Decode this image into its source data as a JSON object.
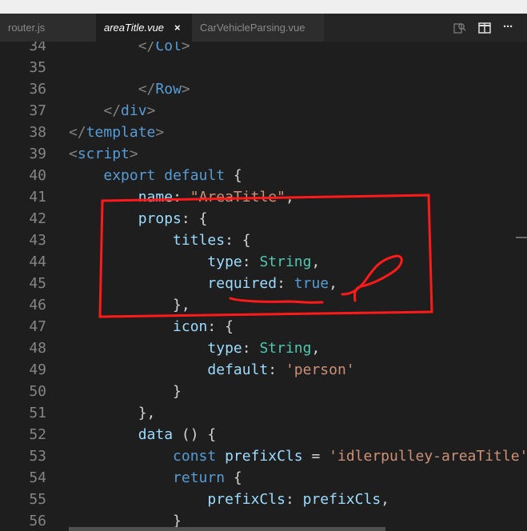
{
  "tabs": [
    {
      "label": "router.js",
      "active": false
    },
    {
      "label": "areaTitle.vue",
      "active": true
    },
    {
      "label": "CarVehicleParsing.vue",
      "active": false
    }
  ],
  "tab_close_glyph": "×",
  "toolbar_icons": [
    "open-changes-icon",
    "split-editor-icon",
    "more-actions-icon"
  ],
  "more_glyph": "···",
  "colors": {
    "background": "#1e1e1e",
    "keyword": "#569cd6",
    "property": "#9cdcfe",
    "type": "#4ec9b0",
    "string": "#ce9178",
    "line_number": "#858585",
    "annotation": "#ff1a1a"
  },
  "code_lines": [
    {
      "n": "34",
      "tokens": [
        [
          "text",
          "        "
        ],
        [
          "punct",
          "</"
        ],
        [
          "tag",
          "Col"
        ],
        [
          "punct",
          ">"
        ]
      ]
    },
    {
      "n": "35",
      "tokens": []
    },
    {
      "n": "36",
      "tokens": [
        [
          "text",
          "        "
        ],
        [
          "punct",
          "</"
        ],
        [
          "tag",
          "Row"
        ],
        [
          "punct",
          ">"
        ]
      ]
    },
    {
      "n": "37",
      "tokens": [
        [
          "text",
          "    "
        ],
        [
          "punct",
          "</"
        ],
        [
          "tag",
          "div"
        ],
        [
          "punct",
          ">"
        ]
      ]
    },
    {
      "n": "38",
      "tokens": [
        [
          "punct",
          "</"
        ],
        [
          "tag",
          "template"
        ],
        [
          "punct",
          ">"
        ]
      ]
    },
    {
      "n": "39",
      "tokens": [
        [
          "punct",
          "<"
        ],
        [
          "tag",
          "script"
        ],
        [
          "punct",
          ">"
        ]
      ]
    },
    {
      "n": "40",
      "tokens": [
        [
          "text",
          "    "
        ],
        [
          "key",
          "export"
        ],
        [
          "text",
          " "
        ],
        [
          "key",
          "default"
        ],
        [
          "text",
          " {"
        ]
      ]
    },
    {
      "n": "41",
      "tokens": [
        [
          "text",
          "        "
        ],
        [
          "prop",
          "name"
        ],
        [
          "text",
          ": "
        ],
        [
          "str",
          "\"AreaTitle\""
        ],
        [
          "text",
          ","
        ]
      ]
    },
    {
      "n": "42",
      "tokens": [
        [
          "text",
          "        "
        ],
        [
          "prop",
          "props"
        ],
        [
          "text",
          ": {"
        ]
      ]
    },
    {
      "n": "43",
      "tokens": [
        [
          "text",
          "            "
        ],
        [
          "prop",
          "titles"
        ],
        [
          "text",
          ": {"
        ]
      ]
    },
    {
      "n": "44",
      "tokens": [
        [
          "text",
          "                "
        ],
        [
          "prop",
          "type"
        ],
        [
          "text",
          ": "
        ],
        [
          "type",
          "String"
        ],
        [
          "text",
          ","
        ]
      ]
    },
    {
      "n": "45",
      "tokens": [
        [
          "text",
          "                "
        ],
        [
          "prop",
          "required"
        ],
        [
          "text",
          ": "
        ],
        [
          "key",
          "true"
        ],
        [
          "text",
          ","
        ]
      ]
    },
    {
      "n": "46",
      "tokens": [
        [
          "text",
          "            },"
        ]
      ]
    },
    {
      "n": "47",
      "tokens": [
        [
          "text",
          "            "
        ],
        [
          "prop",
          "icon"
        ],
        [
          "text",
          ": {"
        ]
      ]
    },
    {
      "n": "48",
      "tokens": [
        [
          "text",
          "                "
        ],
        [
          "prop",
          "type"
        ],
        [
          "text",
          ": "
        ],
        [
          "type",
          "String"
        ],
        [
          "text",
          ","
        ]
      ]
    },
    {
      "n": "49",
      "tokens": [
        [
          "text",
          "                "
        ],
        [
          "prop",
          "default"
        ],
        [
          "text",
          ": "
        ],
        [
          "str",
          "'person'"
        ]
      ]
    },
    {
      "n": "50",
      "tokens": [
        [
          "text",
          "            }"
        ]
      ]
    },
    {
      "n": "51",
      "tokens": [
        [
          "text",
          "        },"
        ]
      ]
    },
    {
      "n": "52",
      "tokens": [
        [
          "text",
          "        "
        ],
        [
          "prop",
          "data"
        ],
        [
          "text",
          " () {"
        ]
      ]
    },
    {
      "n": "53",
      "tokens": [
        [
          "text",
          "            "
        ],
        [
          "key",
          "const"
        ],
        [
          "text",
          " "
        ],
        [
          "prop",
          "prefixCls"
        ],
        [
          "text",
          " = "
        ],
        [
          "str",
          "'idlerpulley-areaTitle'"
        ]
      ]
    },
    {
      "n": "54",
      "tokens": [
        [
          "text",
          "            "
        ],
        [
          "key",
          "return"
        ],
        [
          "text",
          " {"
        ]
      ]
    },
    {
      "n": "55",
      "tokens": [
        [
          "text",
          "                "
        ],
        [
          "prop",
          "prefixCls"
        ],
        [
          "text",
          ": "
        ],
        [
          "prop",
          "prefixCls"
        ],
        [
          "text",
          ","
        ]
      ]
    },
    {
      "n": "56",
      "tokens": [
        [
          "text",
          "            }"
        ]
      ]
    }
  ]
}
